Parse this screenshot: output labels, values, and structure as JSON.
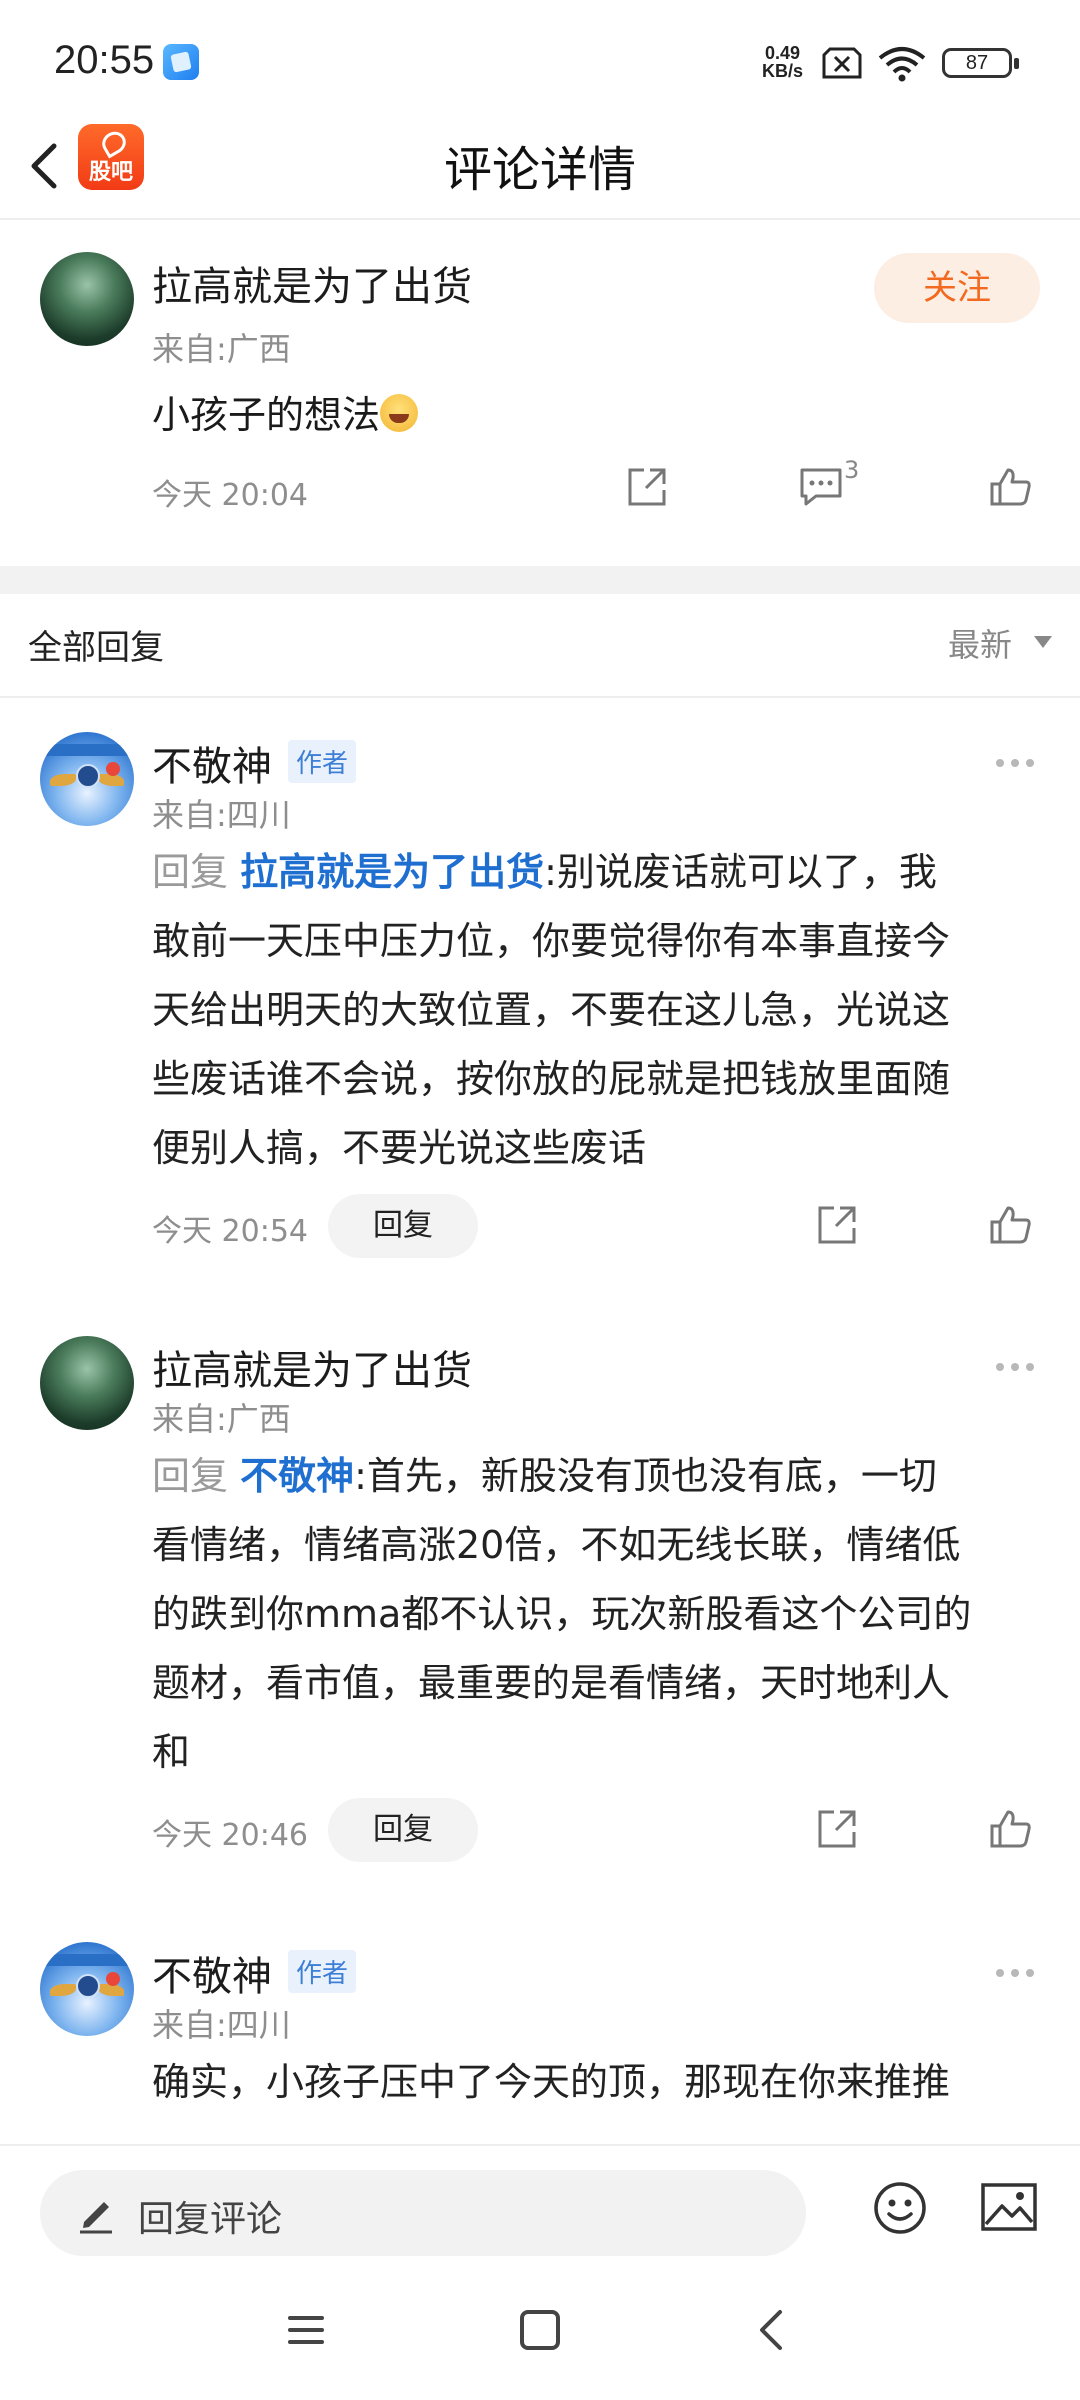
{
  "status_bar": {
    "time": "20:55",
    "net_speed_value": "0.49",
    "net_speed_unit": "KB/s",
    "battery": "87"
  },
  "header": {
    "logo_text": "股吧",
    "title": "评论详情"
  },
  "main_comment": {
    "username": "拉高就是为了出货",
    "location": "来自:广西",
    "follow_label": "关注",
    "text": "小孩子的想法",
    "time": "今天 20:04",
    "reply_count": "3"
  },
  "replies_section": {
    "title": "全部回复",
    "sort_label": "最新"
  },
  "replies": [
    {
      "username": "不敬神",
      "author_tag": "作者",
      "location": "来自:四川",
      "prefix": "回复",
      "target": "拉高就是为了出货",
      "lines": [
        ":别说废话就可以了，我",
        "敢前一天压中压力位，你要觉得你有本事直接今",
        "天给出明天的大致位置，不要在这儿急，光说这",
        "些废话谁不会说，按你放的屁就是把钱放里面随",
        "便别人搞，不要光说这些废话"
      ],
      "time": "今天 20:54",
      "reply_label": "回复"
    },
    {
      "username": "拉高就是为了出货",
      "location": "来自:广西",
      "prefix": "回复",
      "target": "不敬神",
      "lines": [
        ":首先，新股没有顶也没有底，一切",
        "看情绪，情绪高涨20倍，不如无线长联，情绪低",
        "的跌到你mma都不认识，玩次新股看这个公司的",
        "题材，看市值，最重要的是看情绪，天时地利人",
        "和"
      ],
      "time": "今天 20:46",
      "reply_label": "回复"
    },
    {
      "username": "不敬神",
      "author_tag": "作者",
      "location": "来自:四川",
      "lines": [
        "确实，小孩子压中了今天的顶，那现在你来推推"
      ]
    }
  ],
  "bottom_bar": {
    "input_placeholder": "回复评论"
  }
}
